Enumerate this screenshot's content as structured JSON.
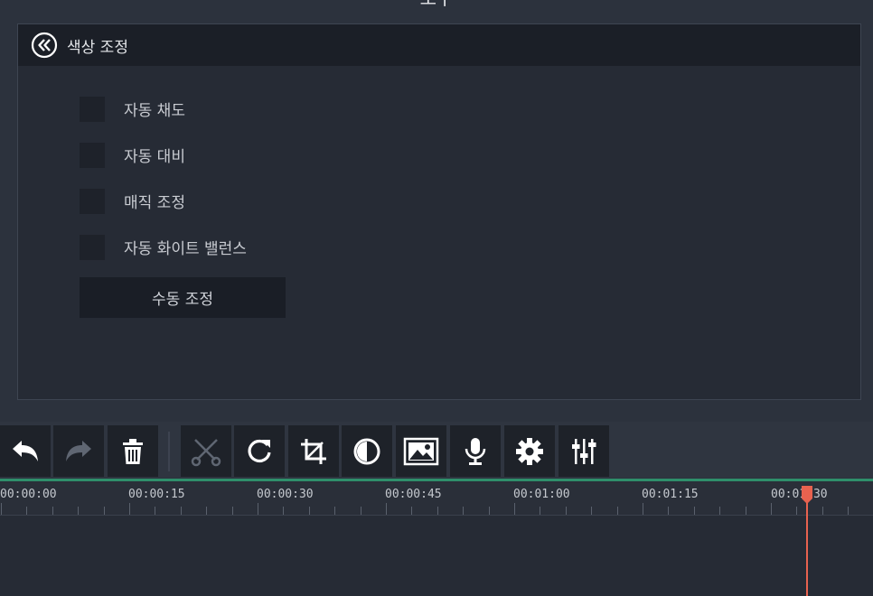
{
  "top_title": "도구",
  "panel": {
    "title": "색상 조정",
    "options": [
      {
        "label": "자동 채도",
        "checked": false
      },
      {
        "label": "자동 대비",
        "checked": false
      },
      {
        "label": "매직 조정",
        "checked": false
      },
      {
        "label": "자동 화이트 밸런스",
        "checked": false
      }
    ],
    "manual_button": "수동 조정"
  },
  "toolbar": {
    "tools": [
      "undo-icon",
      "redo-icon",
      "trash-icon",
      "scissors-icon",
      "rotate-icon",
      "crop-icon",
      "color-adjust-icon",
      "image-icon",
      "microphone-icon",
      "gear-icon",
      "equalizer-icon"
    ]
  },
  "timeline": {
    "timecodes": [
      "00:00:00",
      "00:00:15",
      "00:00:30",
      "00:00:45",
      "00:01:00",
      "00:01:15",
      "00:01:30"
    ],
    "accent_color": "#2f8f6b",
    "playhead_color": "#e8624f"
  }
}
